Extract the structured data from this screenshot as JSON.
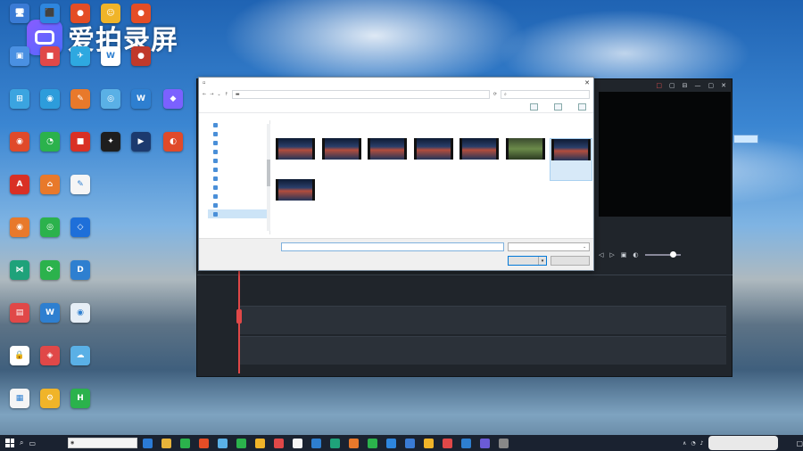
{
  "watermark": {
    "text": "爱拍录屏"
  },
  "desktop_icons": [
    {
      "label": "",
      "color": "#3a7bd5",
      "glyph": "🖥"
    },
    {
      "label": "",
      "color": "#2e86de",
      "glyph": "⬛"
    },
    {
      "label": "",
      "color": "#e44d26",
      "glyph": "●"
    },
    {
      "label": "",
      "color": "#f0b429",
      "glyph": "☺"
    },
    {
      "label": "",
      "color": "#e44d26",
      "glyph": "●"
    },
    {
      "label": "",
      "color": "#4a90e2",
      "glyph": "▣"
    },
    {
      "label": "",
      "color": "#e04848",
      "glyph": "■"
    },
    {
      "label": "",
      "color": "#2ea8e0",
      "glyph": "✈"
    },
    {
      "label": "",
      "color": "#ffffff",
      "glyph": "W"
    },
    {
      "label": "",
      "color": "#c0392b",
      "glyph": "●"
    },
    {
      "label": "",
      "color": "#3ba4e0",
      "glyph": "⊞"
    },
    {
      "label": "",
      "color": "#2d9cdb",
      "glyph": "◉"
    },
    {
      "label": "",
      "color": "#e8792b",
      "glyph": "✎"
    },
    {
      "label": "",
      "color": "#5ab0e6",
      "glyph": "◎"
    },
    {
      "label": "",
      "color": "#2e7fd0",
      "glyph": "W"
    },
    {
      "label": "",
      "color": "#7b61ff",
      "glyph": "◆"
    },
    {
      "label": "",
      "color": "#e04a2a",
      "glyph": "◉"
    },
    {
      "label": "",
      "color": "#2bb24c",
      "glyph": "◔"
    },
    {
      "label": "",
      "color": "#d93025",
      "glyph": "■"
    },
    {
      "label": "",
      "color": "#1e1e1e",
      "glyph": "✦"
    },
    {
      "label": "",
      "color": "#1c3a6e",
      "glyph": "▶"
    },
    {
      "label": "",
      "color": "#e04a2a",
      "glyph": "◐"
    },
    {
      "label": "",
      "color": "#d93025",
      "glyph": "A"
    },
    {
      "label": "",
      "color": "#e8792b",
      "glyph": "⌂"
    },
    {
      "label": "",
      "color": "#f5f5f5",
      "glyph": "✎"
    },
    {
      "label": "",
      "color": "#e8792b",
      "glyph": "◉"
    },
    {
      "label": "",
      "color": "#2bb24c",
      "glyph": "◎"
    },
    {
      "label": "",
      "color": "#1e6fd9",
      "glyph": "◇"
    },
    {
      "label": "",
      "color": "#1fa27a",
      "glyph": "⋈"
    },
    {
      "label": "",
      "color": "#2bb24c",
      "glyph": "⟳"
    },
    {
      "label": "",
      "color": "#2e7fd0",
      "glyph": "D"
    },
    {
      "label": "",
      "color": "#e04848",
      "glyph": "▤"
    },
    {
      "label": "",
      "color": "#2e7fd0",
      "glyph": "W"
    },
    {
      "label": "",
      "color": "#e6eef6",
      "glyph": "◉"
    },
    {
      "label": "",
      "color": "#ffffff",
      "glyph": "🔒"
    },
    {
      "label": "",
      "color": "#e04848",
      "glyph": "◈"
    },
    {
      "label": "",
      "color": "#5ab0e6",
      "glyph": "☁"
    },
    {
      "label": "",
      "color": "#f5f5f5",
      "glyph": "▦"
    },
    {
      "label": "",
      "color": "#f0b429",
      "glyph": "⚙"
    },
    {
      "label": "",
      "color": "#2bb24c",
      "glyph": "H"
    }
  ],
  "dialog": {
    "title": "",
    "close": "✕",
    "path_segments": [
      "",
      "",
      ""
    ],
    "search_placeholder": "",
    "toolbar": {
      "organize": "",
      "new_folder": ""
    },
    "nav_items": [
      "",
      "",
      "",
      "",
      "",
      "",
      "",
      "",
      "",
      "",
      ""
    ],
    "files": [
      {
        "name": "",
        "green": false
      },
      {
        "name": "",
        "green": false
      },
      {
        "name": "",
        "green": false
      },
      {
        "name": "",
        "green": false
      },
      {
        "name": "",
        "green": false
      },
      {
        "name": "",
        "green": true
      },
      {
        "name": "",
        "green": false,
        "selected": true
      },
      {
        "name": "",
        "green": false
      }
    ],
    "filename_label": "",
    "filename_value": "",
    "filetype_value": "",
    "open_label": "",
    "open_split_arrow": "▾",
    "cancel_label": ""
  },
  "editor": {
    "title_icons": [
      "□",
      "▢",
      "⊟",
      "—",
      "▢",
      "✕"
    ],
    "controls": [
      "◁",
      "▷",
      "▣",
      "◐"
    ],
    "control_labels": [
      "",
      "",
      ""
    ],
    "tracks": [
      {
        "label": ""
      },
      {
        "label": ""
      }
    ]
  },
  "activate_windows": {
    "line1": "",
    "line2": ""
  },
  "taskbar": {
    "search_text": "",
    "clock": "",
    "tray_icons": [
      "∧",
      "◔",
      "♪"
    ]
  }
}
